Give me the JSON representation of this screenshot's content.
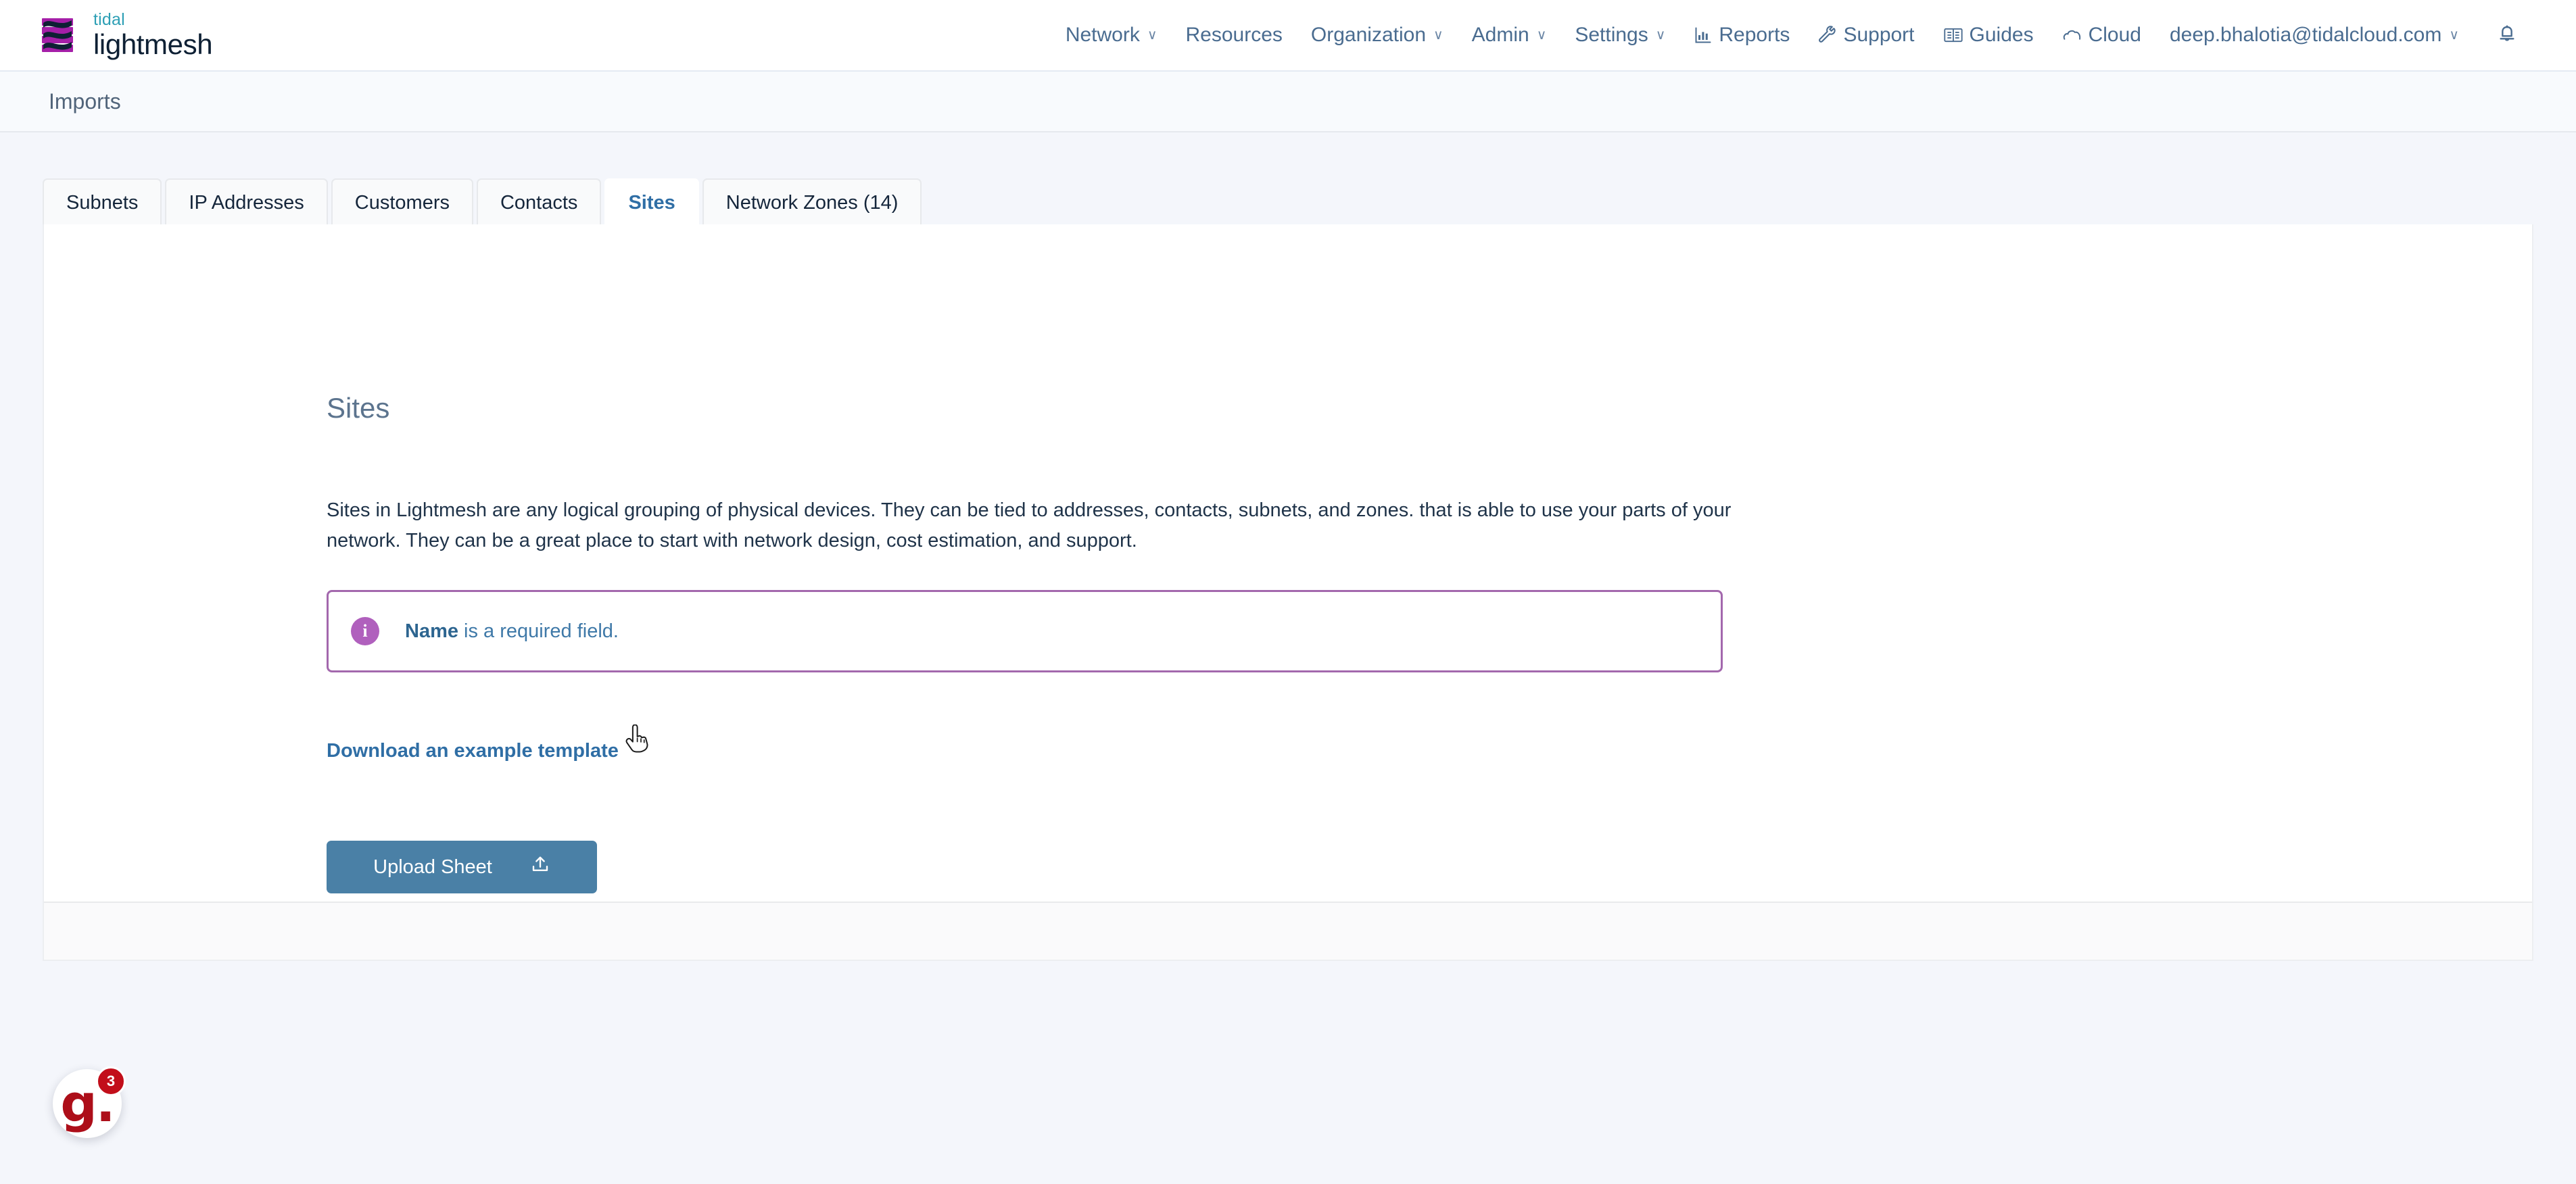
{
  "brand": {
    "logo_icon": "tidal-lightmesh-logo",
    "top_word": "tidal",
    "bottom_word": "lightmesh"
  },
  "navbar": {
    "items": [
      {
        "label": "Network",
        "caret": "∨",
        "has_caret": true,
        "icon": null
      },
      {
        "label": "Resources",
        "caret": "",
        "has_caret": false,
        "icon": null
      },
      {
        "label": "Organization",
        "caret": "∨",
        "has_caret": true,
        "icon": null
      },
      {
        "label": "Admin",
        "caret": "∨",
        "has_caret": true,
        "icon": null
      },
      {
        "label": "Settings",
        "caret": "∨",
        "has_caret": true,
        "icon": null
      },
      {
        "label": "Reports",
        "caret": "",
        "has_caret": false,
        "icon": "bar-chart-icon"
      },
      {
        "label": "Support",
        "caret": "",
        "has_caret": false,
        "icon": "wrench-icon"
      },
      {
        "label": "Guides",
        "caret": "",
        "has_caret": false,
        "icon": "book-icon"
      },
      {
        "label": "Cloud",
        "caret": "",
        "has_caret": false,
        "icon": "cloud-icon"
      }
    ],
    "account": {
      "label": "deep.bhalotia@tidalcloud.com",
      "caret": "∨"
    },
    "notifications_icon": "bell-icon",
    "link_color": "#4a6c90"
  },
  "page_header": {
    "title": "Imports"
  },
  "tabs": [
    {
      "label": "Subnets",
      "active": false
    },
    {
      "label": "IP Addresses",
      "active": false
    },
    {
      "label": "Customers",
      "active": false
    },
    {
      "label": "Contacts",
      "active": false
    },
    {
      "label": "Sites",
      "active": true
    },
    {
      "label": "Network Zones (14)",
      "active": false
    }
  ],
  "panel": {
    "title": "Sites",
    "description": "Sites in Lightmesh are any logical grouping of physical devices. They can be tied to addresses, contacts, subnets, and zones. that is able to use your parts of your network. They can be a great place to start with network design, cost estimation, and support.",
    "alert": {
      "icon": "info-circle-icon",
      "icon_glyph": "i",
      "strong_text": "Name",
      "text": " is a required field.",
      "border_color": "#a368ad",
      "icon_color": "#b060bd",
      "text_color": "#3f79a8"
    },
    "download_link": "Download an example template",
    "upload_button": {
      "label": "Upload Sheet",
      "icon": "upload-icon",
      "color": "#4a80a6"
    }
  },
  "chat_widget": {
    "logo_text": "g.",
    "badge_count": "3",
    "badge_color": "#c20e1a",
    "logo_color": "#ad0e19"
  },
  "cursor": {
    "icon": "pointer-hand-cursor"
  }
}
